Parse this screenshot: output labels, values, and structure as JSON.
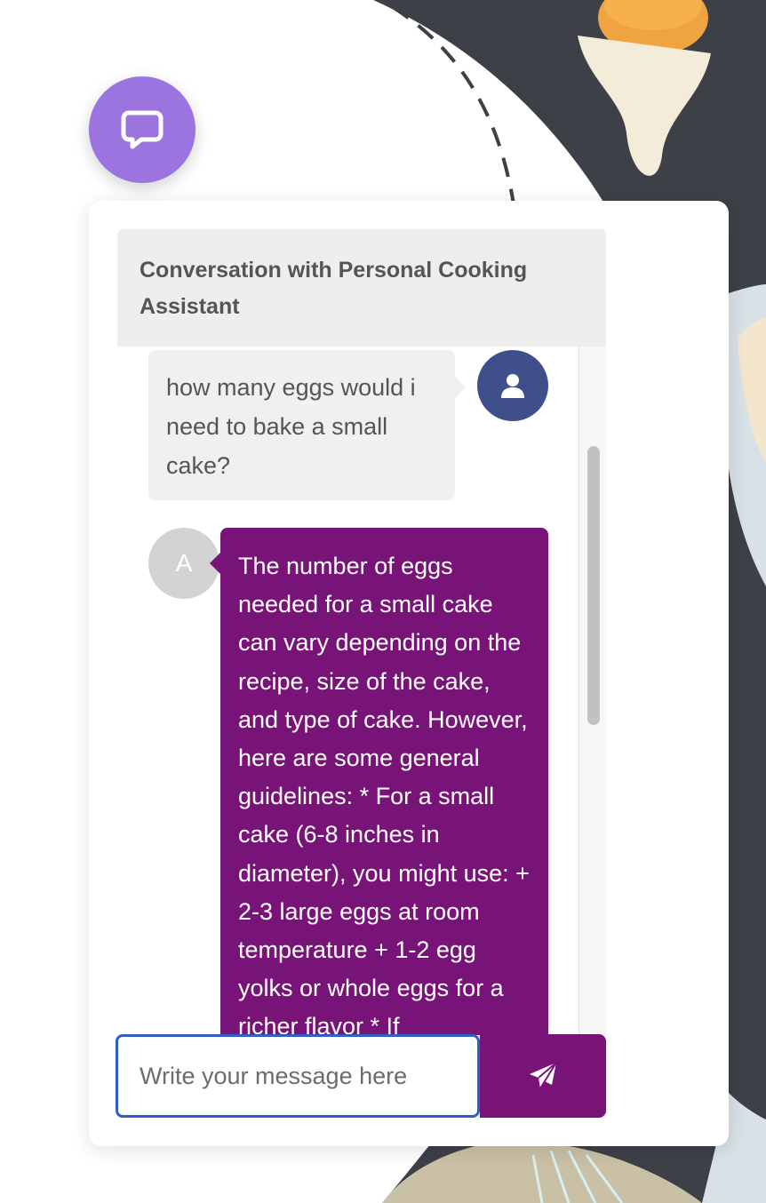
{
  "launcher": {
    "icon": "chat-bubble-icon"
  },
  "chat": {
    "title": "Conversation with Personal Cooking Assistant",
    "messages": [
      {
        "role": "user",
        "avatar_icon": "user-icon",
        "text": "how many eggs would i need to bake a small cake?"
      },
      {
        "role": "assistant",
        "avatar_letter": "A",
        "text": "The number of eggs needed for a small cake can vary depending on the recipe, size of the cake, and type of cake. However, here are some general guidelines: * For a small cake (6-8 inches in diameter), you might use: + 2-3 large eggs at room temperature + 1-2 egg yolks or whole eggs for a richer flavor * If"
      }
    ]
  },
  "composer": {
    "placeholder": "Write your message here",
    "value": "",
    "send_icon": "paper-plane-icon"
  },
  "colors": {
    "launcher": "#9b74e0",
    "user_avatar": "#3f4f8c",
    "assistant_bubble": "#781478",
    "input_focus_border": "#2f5fc4",
    "background_dark": "#3d4047"
  }
}
